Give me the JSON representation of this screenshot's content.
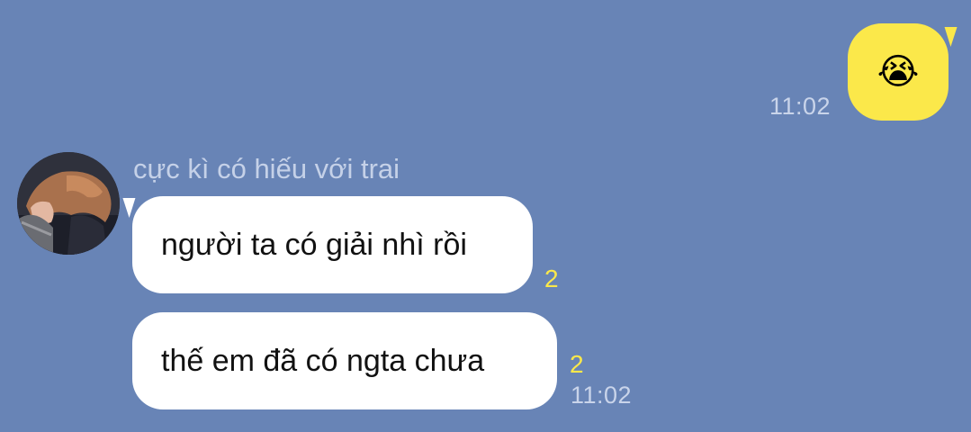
{
  "colors": {
    "background": "#6884b6",
    "outgoing_bubble": "#fbe84a",
    "incoming_bubble": "#ffffff",
    "unread_count": "#fbe84a",
    "meta_text": "#c9d4ea"
  },
  "outgoing_message": {
    "emoji": "😭",
    "emoji_name": "loudly-crying-face-icon",
    "time": "11:02"
  },
  "incoming": {
    "sender_name": "cực kì có hiếu với trai",
    "avatar_icon": "avatar-photo",
    "messages": [
      {
        "text": "người ta có giải nhì rồi",
        "unread": "2"
      },
      {
        "text": "thế em đã có ngta chưa",
        "unread": "2"
      }
    ],
    "time": "11:02"
  }
}
